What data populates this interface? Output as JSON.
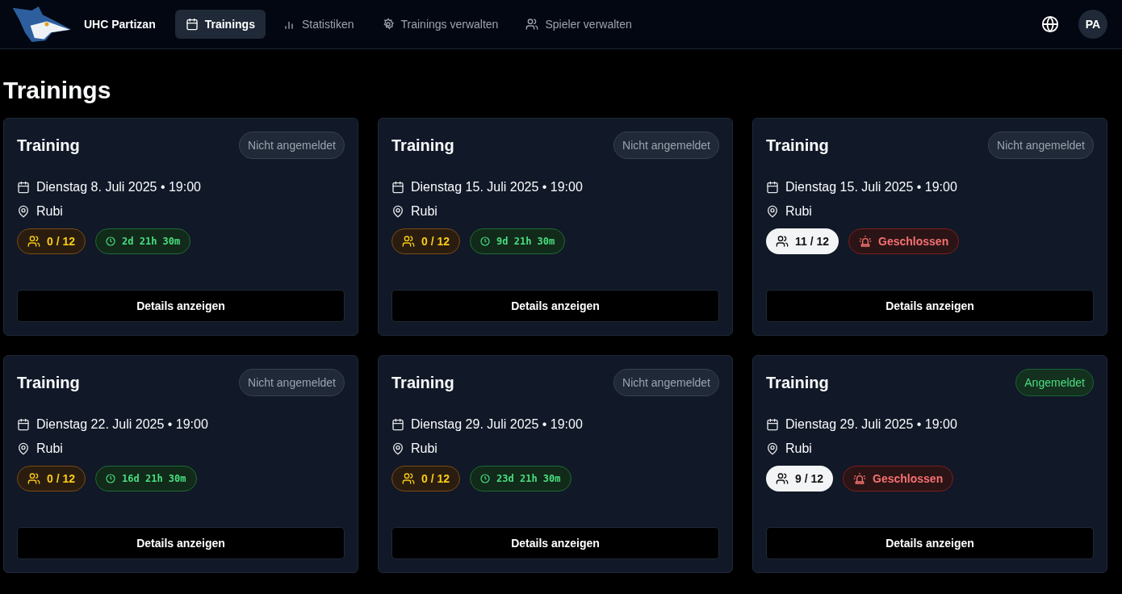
{
  "brand": {
    "name": "UHC Partizan"
  },
  "nav": [
    {
      "label": "Trainings",
      "kind": "calendar",
      "selected": true
    },
    {
      "label": "Statistiken",
      "kind": "chart",
      "selected": false
    },
    {
      "label": "Trainings verwalten",
      "kind": "gear",
      "selected": false
    },
    {
      "label": "Spieler verwalten",
      "kind": "users",
      "selected": false
    }
  ],
  "user": {
    "initials": "PA"
  },
  "page_title": "Trainings",
  "trainings": [
    {
      "title": "Training",
      "registration": "Nicht angemeldet",
      "registered": false,
      "date": "Dienstag 8. Juli 2025 • 19:00",
      "location": "Rubi",
      "participants": {
        "text": "0 / 12",
        "kind": "low"
      },
      "status": {
        "kind": "countdown",
        "text": "2d 21h 30m"
      },
      "button": "Details anzeigen"
    },
    {
      "title": "Training",
      "registration": "Nicht angemeldet",
      "registered": false,
      "date": "Dienstag 15. Juli 2025 • 19:00",
      "location": "Rubi",
      "participants": {
        "text": "0 / 12",
        "kind": "low"
      },
      "status": {
        "kind": "countdown",
        "text": "9d 21h 30m"
      },
      "button": "Details anzeigen"
    },
    {
      "title": "Training",
      "registration": "Nicht angemeldet",
      "registered": false,
      "date": "Dienstag 15. Juli 2025 • 19:00",
      "location": "Rubi",
      "participants": {
        "text": "11 / 12",
        "kind": "ok"
      },
      "status": {
        "kind": "closed",
        "text": "Geschlossen"
      },
      "button": "Details anzeigen"
    },
    {
      "title": "Training",
      "registration": "Nicht angemeldet",
      "registered": false,
      "date": "Dienstag 22. Juli 2025 • 19:00",
      "location": "Rubi",
      "participants": {
        "text": "0 / 12",
        "kind": "low"
      },
      "status": {
        "kind": "countdown",
        "text": "16d 21h 30m"
      },
      "button": "Details anzeigen"
    },
    {
      "title": "Training",
      "registration": "Nicht angemeldet",
      "registered": false,
      "date": "Dienstag 29. Juli 2025 • 19:00",
      "location": "Rubi",
      "participants": {
        "text": "0 / 12",
        "kind": "low"
      },
      "status": {
        "kind": "countdown",
        "text": "23d 21h 30m"
      },
      "button": "Details anzeigen"
    },
    {
      "title": "Training",
      "registration": "Angemeldet",
      "registered": true,
      "date": "Dienstag 29. Juli 2025 • 19:00",
      "location": "Rubi",
      "participants": {
        "text": "9 / 12",
        "kind": "ok"
      },
      "status": {
        "kind": "closed",
        "text": "Geschlossen"
      },
      "button": "Details anzeigen"
    }
  ]
}
